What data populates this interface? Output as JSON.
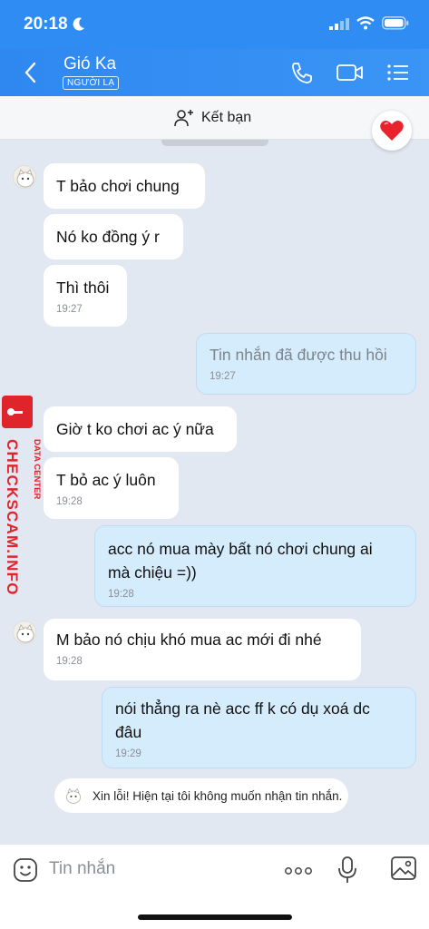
{
  "status_bar": {
    "time": "20:18"
  },
  "header": {
    "contact_name": "Gió Ka",
    "stranger_label": "NGƯỜI LẠ"
  },
  "add_friend": {
    "label": "Kết bạn"
  },
  "messages": [
    {
      "dir": "in",
      "text": "T bảo chơi chung",
      "time": ""
    },
    {
      "dir": "in",
      "text": "Nó ko đồng ý r",
      "time": ""
    },
    {
      "dir": "in",
      "text": "Thì thôi",
      "time": "19:27"
    },
    {
      "dir": "out",
      "text": "Tin nhắn đã được thu hồi",
      "time": "19:27",
      "recalled": true
    },
    {
      "dir": "in",
      "text": "Giờ t ko chơi ac ý nữa",
      "time": ""
    },
    {
      "dir": "in",
      "text": "T bỏ ac ý luôn",
      "time": "19:28"
    },
    {
      "dir": "out",
      "line1": "acc nó mua mày bất nó chơi chung ai",
      "line2": "mà chiệu =))",
      "time": "19:28"
    },
    {
      "dir": "in",
      "text": "M bảo nó chịu khó mua ac mới đi nhé",
      "time": "19:28"
    },
    {
      "dir": "out",
      "line1": "nói thẳng ra nè acc ff k có dụ xoá dc",
      "line2": "đâu",
      "time": "19:29"
    }
  ],
  "notice": {
    "text": "Xin lỗi! Hiện tại tôi không muốn nhận tin nhắn."
  },
  "composer": {
    "placeholder": "Tin nhắn"
  },
  "watermark": {
    "small": "DATA CENTER",
    "big": "CHECKSCAM.INFO"
  },
  "colors": {
    "header": "#2f8cf2",
    "incoming_bubble": "#ffffff",
    "outgoing_bubble": "#d5ecfc",
    "chat_bg": "#e2e8f1",
    "watermark": "#e0242c"
  },
  "icons": [
    "moon-icon",
    "signal-icon",
    "wifi-icon",
    "battery-icon",
    "back-arrow-icon",
    "phone-icon",
    "video-call-icon",
    "menu-icon",
    "add-person-icon",
    "heart-icon",
    "emoji-icon",
    "more-icon",
    "microphone-icon",
    "image-icon"
  ]
}
